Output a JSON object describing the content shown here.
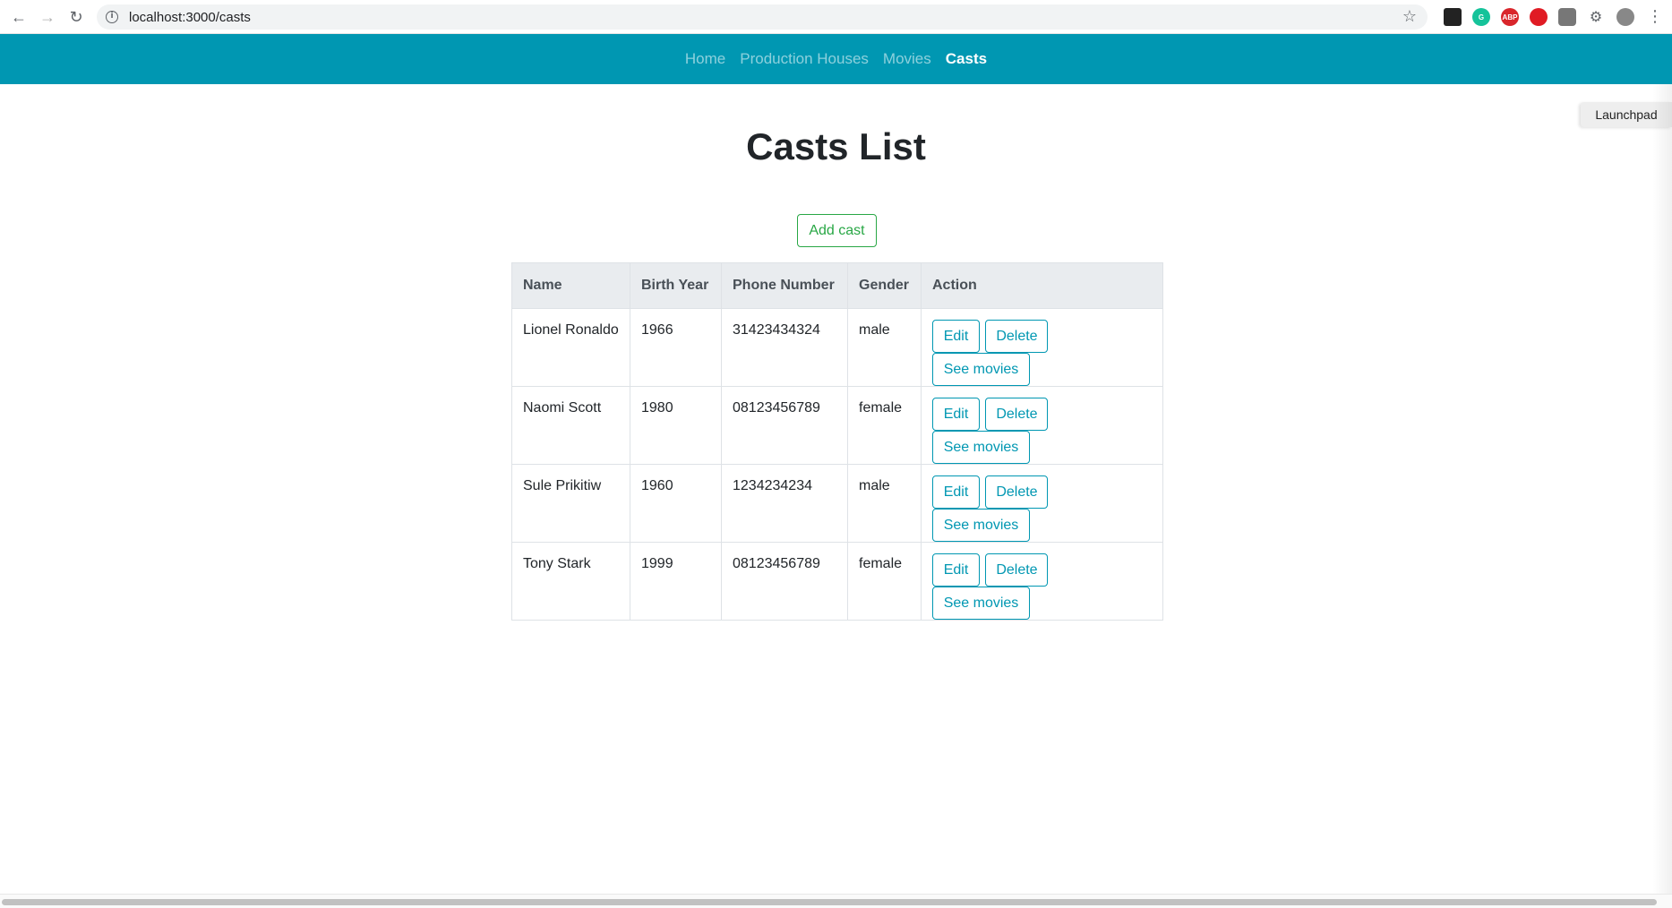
{
  "browser": {
    "url": "localhost:3000/casts"
  },
  "navbar": {
    "items": [
      {
        "label": "Home",
        "active": false
      },
      {
        "label": "Production Houses",
        "active": false
      },
      {
        "label": "Movies",
        "active": false
      },
      {
        "label": "Casts",
        "active": true
      }
    ]
  },
  "launchpad": {
    "label": "Launchpad"
  },
  "page": {
    "title": "Casts List",
    "add_button": "Add cast"
  },
  "table": {
    "headers": [
      "Name",
      "Birth Year",
      "Phone Number",
      "Gender",
      "Action"
    ],
    "rows": [
      {
        "name": "Lionel Ronaldo",
        "birth_year": "1966",
        "phone": "31423434324",
        "gender": "male"
      },
      {
        "name": "Naomi Scott",
        "birth_year": "1980",
        "phone": "08123456789",
        "gender": "female"
      },
      {
        "name": "Sule Prikitiw",
        "birth_year": "1960",
        "phone": "1234234234",
        "gender": "male"
      },
      {
        "name": "Tony Stark",
        "birth_year": "1999",
        "phone": "08123456789",
        "gender": "female"
      }
    ],
    "actions": {
      "edit": "Edit",
      "delete": "Delete",
      "see_movies": "See movies"
    }
  },
  "colors": {
    "navbar": "#0097b2",
    "success": "#28a745",
    "info": "#0097b2"
  }
}
